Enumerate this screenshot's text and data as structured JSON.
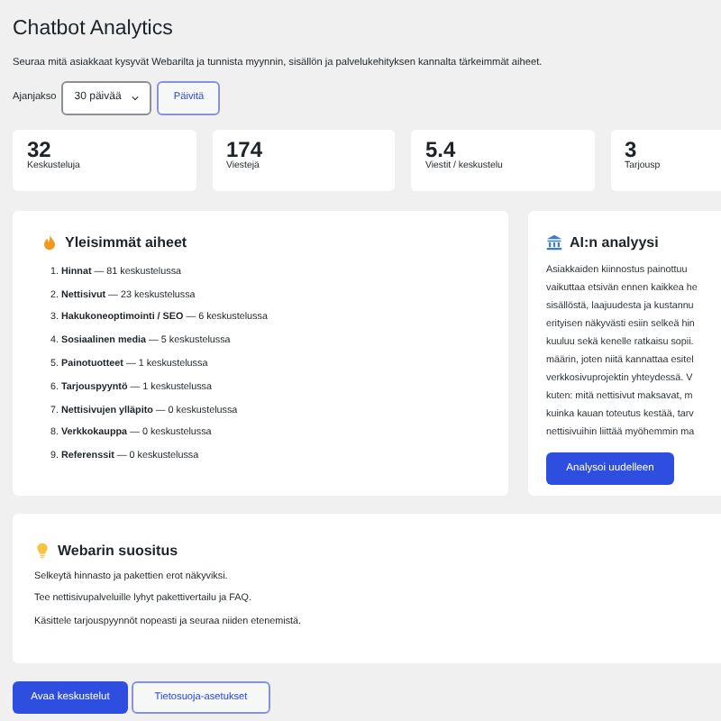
{
  "title": "Chatbot Analytics",
  "description": "Seuraa mitä asiakkaat kysyvät Webarilta ja tunnista myynnin, sisällön ja palvelukehityksen kannalta tärkeimmät aiheet.",
  "period": {
    "label": "Ajanjakso",
    "value": "30 päivää",
    "button": "Päivitä"
  },
  "stats": [
    {
      "value": "32",
      "label": "Keskusteluja"
    },
    {
      "value": "174",
      "label": "Viestejä"
    },
    {
      "value": "5.4",
      "label": "Viestit / keskustelu"
    },
    {
      "value": "3",
      "label": "Tarjousp"
    }
  ],
  "topics": {
    "title": "Yleisimmät aiheet",
    "items": [
      {
        "number": "1.",
        "name": "Hinnat",
        "count": "— 81 keskustelussa"
      },
      {
        "number": "2.",
        "name": "Nettisivut",
        "count": "— 23 keskustelussa"
      },
      {
        "number": "3.",
        "name": "Hakukoneoptimointi / SEO",
        "count": "— 6 keskustelussa"
      },
      {
        "number": "4.",
        "name": "Sosiaalinen media",
        "count": "— 5 keskustelussa"
      },
      {
        "number": "5.",
        "name": "Painotuotteet",
        "count": "— 1 keskustelussa"
      },
      {
        "number": "6.",
        "name": "Tarjouspyyntö",
        "count": "— 1 keskustelussa"
      },
      {
        "number": "7.",
        "name": "Nettisivujen ylläpito",
        "count": "— 0 keskustelussa"
      },
      {
        "number": "8.",
        "name": "Verkkokauppa",
        "count": "— 0 keskustelussa"
      },
      {
        "number": "9.",
        "name": "Referenssit",
        "count": "— 0 keskustelussa"
      }
    ]
  },
  "analysis": {
    "title": "AI:n analyysi",
    "lines": [
      "Asiakkaiden kiinnostus painottuu",
      "vaikuttaa etsivän ennen kaikkea he",
      "sisällöstä, laajuudesta ja kustannu",
      "erityisen näkyvästi esiin selkeä hin",
      "kuuluu sekä kenelle ratkaisu sopii.",
      "määrin, joten niitä kannattaa esitel",
      "verkkosivuprojektin yhteydessä. V",
      "kuten: mitä nettisivut maksavat, m",
      "kuinka kauan toteutus kestää, tarv",
      "nettisivuihin liittää myöhemmin ma"
    ],
    "button": "Analysoi uudelleen"
  },
  "recommendation": {
    "title": "Webarin suositus",
    "lines": [
      "Selkeytä hinnasto ja pakettien erot näkyviksi.",
      "Tee nettisivupalveluille lyhyt pakettivertailu ja FAQ.",
      "Käsittele tarjouspyynnöt nopeasti ja seuraa niiden etenemistä."
    ]
  },
  "actions": [
    {
      "label": "Avaa keskustelut",
      "kind": "primary"
    },
    {
      "label": "Tietosuoja-asetukset",
      "kind": "secondary"
    }
  ]
}
